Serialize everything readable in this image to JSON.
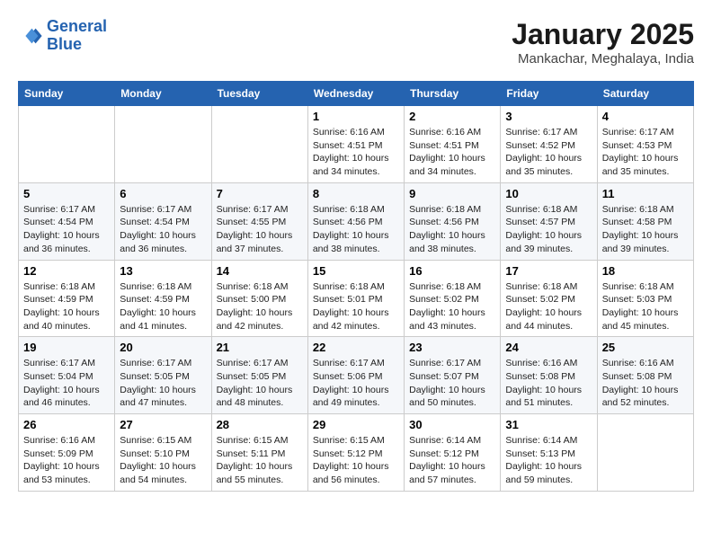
{
  "header": {
    "logo_line1": "General",
    "logo_line2": "Blue",
    "month": "January 2025",
    "location": "Mankachar, Meghalaya, India"
  },
  "weekdays": [
    "Sunday",
    "Monday",
    "Tuesday",
    "Wednesday",
    "Thursday",
    "Friday",
    "Saturday"
  ],
  "weeks": [
    [
      {
        "day": "",
        "info": ""
      },
      {
        "day": "",
        "info": ""
      },
      {
        "day": "",
        "info": ""
      },
      {
        "day": "1",
        "info": "Sunrise: 6:16 AM\nSunset: 4:51 PM\nDaylight: 10 hours\nand 34 minutes."
      },
      {
        "day": "2",
        "info": "Sunrise: 6:16 AM\nSunset: 4:51 PM\nDaylight: 10 hours\nand 34 minutes."
      },
      {
        "day": "3",
        "info": "Sunrise: 6:17 AM\nSunset: 4:52 PM\nDaylight: 10 hours\nand 35 minutes."
      },
      {
        "day": "4",
        "info": "Sunrise: 6:17 AM\nSunset: 4:53 PM\nDaylight: 10 hours\nand 35 minutes."
      }
    ],
    [
      {
        "day": "5",
        "info": "Sunrise: 6:17 AM\nSunset: 4:54 PM\nDaylight: 10 hours\nand 36 minutes."
      },
      {
        "day": "6",
        "info": "Sunrise: 6:17 AM\nSunset: 4:54 PM\nDaylight: 10 hours\nand 36 minutes."
      },
      {
        "day": "7",
        "info": "Sunrise: 6:17 AM\nSunset: 4:55 PM\nDaylight: 10 hours\nand 37 minutes."
      },
      {
        "day": "8",
        "info": "Sunrise: 6:18 AM\nSunset: 4:56 PM\nDaylight: 10 hours\nand 38 minutes."
      },
      {
        "day": "9",
        "info": "Sunrise: 6:18 AM\nSunset: 4:56 PM\nDaylight: 10 hours\nand 38 minutes."
      },
      {
        "day": "10",
        "info": "Sunrise: 6:18 AM\nSunset: 4:57 PM\nDaylight: 10 hours\nand 39 minutes."
      },
      {
        "day": "11",
        "info": "Sunrise: 6:18 AM\nSunset: 4:58 PM\nDaylight: 10 hours\nand 39 minutes."
      }
    ],
    [
      {
        "day": "12",
        "info": "Sunrise: 6:18 AM\nSunset: 4:59 PM\nDaylight: 10 hours\nand 40 minutes."
      },
      {
        "day": "13",
        "info": "Sunrise: 6:18 AM\nSunset: 4:59 PM\nDaylight: 10 hours\nand 41 minutes."
      },
      {
        "day": "14",
        "info": "Sunrise: 6:18 AM\nSunset: 5:00 PM\nDaylight: 10 hours\nand 42 minutes."
      },
      {
        "day": "15",
        "info": "Sunrise: 6:18 AM\nSunset: 5:01 PM\nDaylight: 10 hours\nand 42 minutes."
      },
      {
        "day": "16",
        "info": "Sunrise: 6:18 AM\nSunset: 5:02 PM\nDaylight: 10 hours\nand 43 minutes."
      },
      {
        "day": "17",
        "info": "Sunrise: 6:18 AM\nSunset: 5:02 PM\nDaylight: 10 hours\nand 44 minutes."
      },
      {
        "day": "18",
        "info": "Sunrise: 6:18 AM\nSunset: 5:03 PM\nDaylight: 10 hours\nand 45 minutes."
      }
    ],
    [
      {
        "day": "19",
        "info": "Sunrise: 6:17 AM\nSunset: 5:04 PM\nDaylight: 10 hours\nand 46 minutes."
      },
      {
        "day": "20",
        "info": "Sunrise: 6:17 AM\nSunset: 5:05 PM\nDaylight: 10 hours\nand 47 minutes."
      },
      {
        "day": "21",
        "info": "Sunrise: 6:17 AM\nSunset: 5:05 PM\nDaylight: 10 hours\nand 48 minutes."
      },
      {
        "day": "22",
        "info": "Sunrise: 6:17 AM\nSunset: 5:06 PM\nDaylight: 10 hours\nand 49 minutes."
      },
      {
        "day": "23",
        "info": "Sunrise: 6:17 AM\nSunset: 5:07 PM\nDaylight: 10 hours\nand 50 minutes."
      },
      {
        "day": "24",
        "info": "Sunrise: 6:16 AM\nSunset: 5:08 PM\nDaylight: 10 hours\nand 51 minutes."
      },
      {
        "day": "25",
        "info": "Sunrise: 6:16 AM\nSunset: 5:08 PM\nDaylight: 10 hours\nand 52 minutes."
      }
    ],
    [
      {
        "day": "26",
        "info": "Sunrise: 6:16 AM\nSunset: 5:09 PM\nDaylight: 10 hours\nand 53 minutes."
      },
      {
        "day": "27",
        "info": "Sunrise: 6:15 AM\nSunset: 5:10 PM\nDaylight: 10 hours\nand 54 minutes."
      },
      {
        "day": "28",
        "info": "Sunrise: 6:15 AM\nSunset: 5:11 PM\nDaylight: 10 hours\nand 55 minutes."
      },
      {
        "day": "29",
        "info": "Sunrise: 6:15 AM\nSunset: 5:12 PM\nDaylight: 10 hours\nand 56 minutes."
      },
      {
        "day": "30",
        "info": "Sunrise: 6:14 AM\nSunset: 5:12 PM\nDaylight: 10 hours\nand 57 minutes."
      },
      {
        "day": "31",
        "info": "Sunrise: 6:14 AM\nSunset: 5:13 PM\nDaylight: 10 hours\nand 59 minutes."
      },
      {
        "day": "",
        "info": ""
      }
    ]
  ]
}
